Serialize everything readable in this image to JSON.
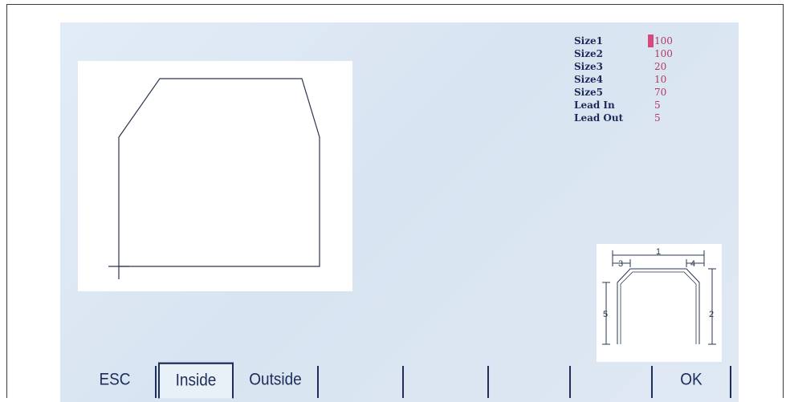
{
  "params": [
    {
      "label": "Size1",
      "value": "100",
      "active": true
    },
    {
      "label": "Size2",
      "value": "100"
    },
    {
      "label": "Size3",
      "value": "20"
    },
    {
      "label": "Size4",
      "value": "10"
    },
    {
      "label": "Size5",
      "value": "70"
    },
    {
      "label": "Lead In",
      "value": "5"
    },
    {
      "label": "Lead Out",
      "value": "5"
    }
  ],
  "diagram_labels": {
    "d1": "1",
    "d2": "2",
    "d3": "3",
    "d4": "4",
    "d5": "5"
  },
  "softkeys": [
    "ESC",
    "Inside",
    "Outside",
    "",
    "",
    "",
    "",
    "OK"
  ],
  "selected_softkey": "Inside",
  "colors": {
    "screen_bg": "#dde8f3",
    "label": "#1c2a5a",
    "value": "#b03a62",
    "cursor": "#d8487a",
    "shape_line": "#2b3550"
  }
}
